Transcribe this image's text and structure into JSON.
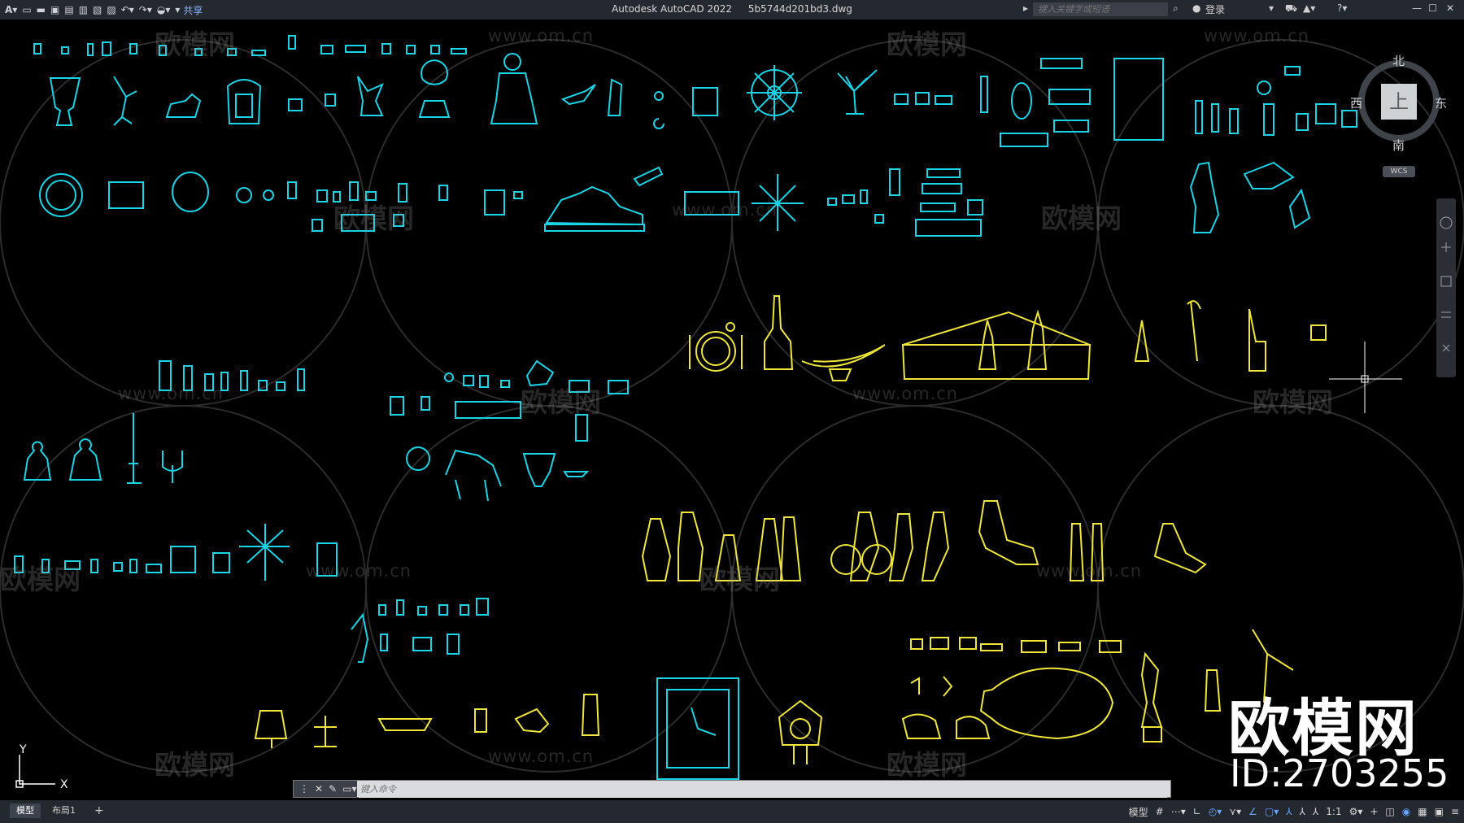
{
  "app": {
    "title": "Autodesk AutoCAD 2022",
    "document": "5b5744d201bd3.dwg",
    "share_label": "共享",
    "search_placeholder": "键入关键字或短语",
    "login_label": "登录"
  },
  "watermark": {
    "url": "www.om.cn",
    "brand": "欧模网",
    "big_brand": "欧模网",
    "id_text": "ID:2703255"
  },
  "viewcube": {
    "north": "北",
    "south": "南",
    "east": "东",
    "west": "西",
    "top_face": "上",
    "wcs": "WCS"
  },
  "command_line": {
    "placeholder": "键入命令"
  },
  "status_bar": {
    "tabs": [
      "模型",
      "布局1"
    ],
    "add_tab": "+",
    "model_label": "模型",
    "scale": "1:1"
  },
  "ucs": {
    "x_label": "X",
    "y_label": "Y"
  },
  "colors": {
    "cyan_objects": "#19d4e6",
    "yellow_objects": "#f0e63a",
    "background": "#000000"
  }
}
